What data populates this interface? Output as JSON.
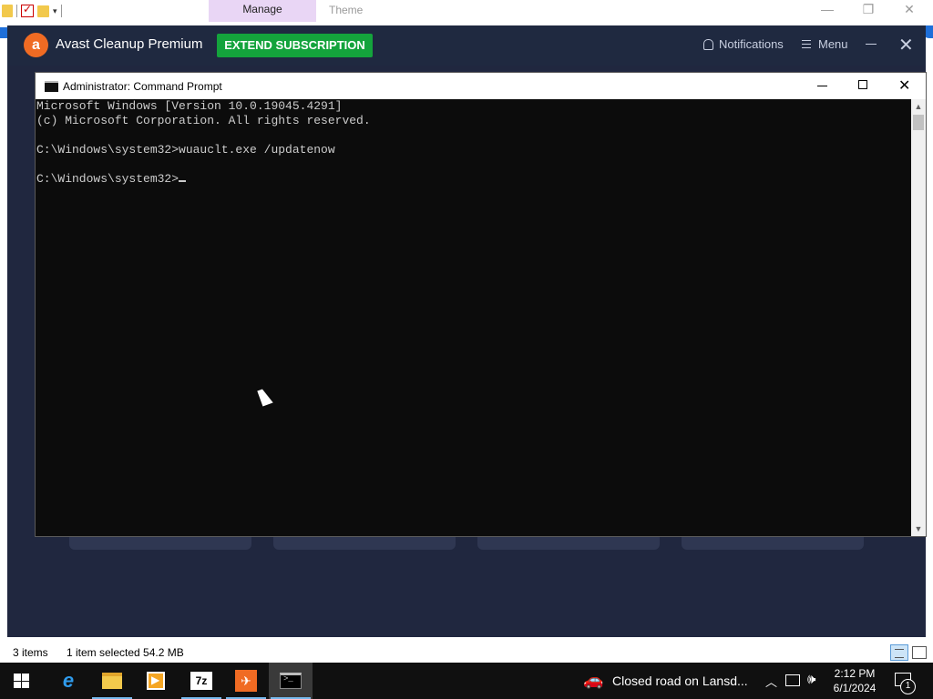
{
  "explorer": {
    "ribbon_tabs": [
      {
        "label": "Manage"
      },
      {
        "label": "Theme"
      }
    ],
    "status": {
      "items": "3 items",
      "selected": "1 item selected  54.2 MB"
    }
  },
  "avast": {
    "title": "Avast Cleanup Premium",
    "extend_label": "EXTEND SUBSCRIPTION",
    "notifications_label": "Notifications",
    "menu_label": "Menu",
    "colors": {
      "background": "#20273f",
      "header": "#1f2940",
      "accent": "#14a33c",
      "brand": "#f06b23"
    }
  },
  "cmd": {
    "title": "Administrator: Command Prompt",
    "lines": [
      "Microsoft Windows [Version 10.0.19045.4291]",
      "(c) Microsoft Corporation. All rights reserved.",
      "",
      "C:\\Windows\\system32>wuauclt.exe /updatenow",
      "",
      "C:\\Windows\\system32>"
    ]
  },
  "taskbar": {
    "apps": [
      {
        "name": "internet-explorer-icon",
        "active": false
      },
      {
        "name": "file-explorer-icon",
        "active": true
      },
      {
        "name": "media-player-icon",
        "active": false
      },
      {
        "name": "7zip-icon",
        "active": true,
        "label": "7z"
      },
      {
        "name": "avast-icon",
        "active": true
      },
      {
        "name": "command-prompt-icon",
        "active": true
      }
    ],
    "news_text": "Closed road on Lansd...",
    "clock_time": "2:12 PM",
    "clock_date": "6/1/2024",
    "notification_count": "1"
  }
}
